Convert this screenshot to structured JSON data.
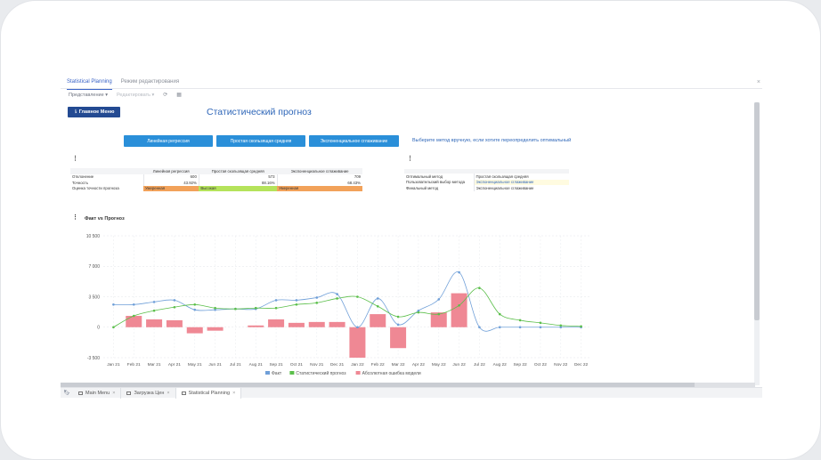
{
  "tabs": [
    {
      "label": "Statistical Planning",
      "active": true
    },
    {
      "label": "Режим редактирования",
      "active": false
    }
  ],
  "toolbar": {
    "view_label": "Представление",
    "edit_label": "Редактировать"
  },
  "main_menu_button": "⇂ Главное Меню",
  "page_title": "Статистический прогноз",
  "method_buttons": [
    "Линейная регрессия",
    "Простая скользящая средняя",
    "Экспоненциальное сглаживание"
  ],
  "method_hint": "Выберите метод вручную, если хотите переопределить оптимальный",
  "accuracy_table": {
    "headers": [
      "",
      "Линейная регрессия",
      "Простая скользящая средняя",
      "Экспоненциальное сглаживание"
    ],
    "rows": [
      {
        "label": "Отклонение",
        "values": [
          "600",
          "573",
          "709"
        ]
      },
      {
        "label": "Точность",
        "values": [
          "43.92%",
          "88.16%",
          "68.43%"
        ]
      },
      {
        "label": "Оценка точности прогноза",
        "values": [
          "Умеренная",
          "Высокая",
          "Умеренная"
        ]
      }
    ],
    "rating_colors": [
      "#f2a25a",
      "#b5e35b",
      "#f2a25a"
    ]
  },
  "method_table": {
    "rows": [
      {
        "label": "Оптимальный метод",
        "value": "Простая скользящая средняя"
      },
      {
        "label": "Пользовательский выбор метода",
        "value": "Экспоненциальное сглаживание"
      },
      {
        "label": "Финальный метод",
        "value": "Экспоненциальное сглаживание"
      }
    ]
  },
  "chart_title": "Факт vs Прогноз",
  "chart_data": {
    "type": "line",
    "categories": [
      "Jan 21",
      "Feb 21",
      "Mar 21",
      "Apr 21",
      "May 21",
      "Jun 21",
      "Jul 21",
      "Aug 21",
      "Sep 21",
      "Oct 21",
      "Nov 21",
      "Dec 21",
      "Jan 22",
      "Feb 22",
      "Mar 22",
      "Apr 22",
      "May 22",
      "Jun 22",
      "Jul 22",
      "Aug 22",
      "Sep 22",
      "Oct 22",
      "Nov 22",
      "Dec 22"
    ],
    "ylim": [
      -3500,
      10500
    ],
    "yticks": [
      "-3 500",
      "0",
      "3 500",
      "7 000",
      "10 500"
    ],
    "series": [
      {
        "name": "Факт",
        "type": "line",
        "color": "#6f9fd8",
        "values": [
          2600,
          2600,
          2900,
          3100,
          2000,
          2000,
          2100,
          2100,
          3100,
          3100,
          3400,
          3800,
          0,
          3300,
          300,
          1900,
          3200,
          6300,
          0,
          0,
          0,
          0,
          0,
          0
        ]
      },
      {
        "name": "Статистический прогноз",
        "type": "line",
        "color": "#5bbf4a",
        "values": [
          0,
          1300,
          1900,
          2300,
          2600,
          2200,
          2100,
          2200,
          2200,
          2600,
          2800,
          3300,
          3500,
          2400,
          1200,
          1700,
          1500,
          2500,
          4500,
          1500,
          800,
          500,
          200,
          100
        ]
      },
      {
        "name": "Абсолютная ошибка модели",
        "type": "bar",
        "color": "#ef8894",
        "values": [
          0,
          1300,
          900,
          800,
          -700,
          -400,
          0,
          200,
          900,
          500,
          600,
          600,
          -3500,
          1500,
          -2400,
          0,
          1700,
          3900,
          0,
          0,
          0,
          0,
          0,
          0
        ]
      }
    ]
  },
  "bottom_tabs": [
    {
      "label": "Main Menu",
      "active": false
    },
    {
      "label": "Загрузка Цен",
      "active": false
    },
    {
      "label": "Statistical Planning",
      "active": true
    }
  ]
}
